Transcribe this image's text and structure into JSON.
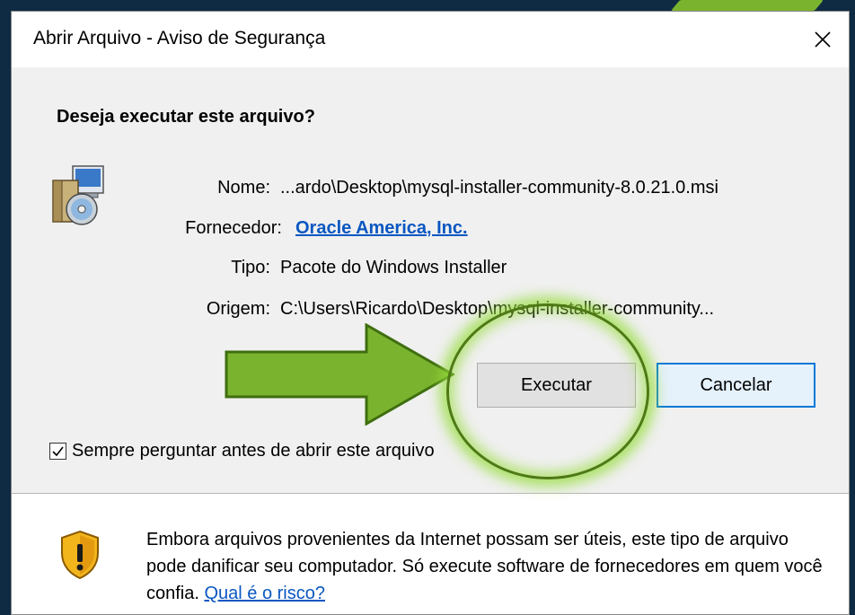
{
  "dialog": {
    "title": "Abrir Arquivo - Aviso de Segurança",
    "close_glyph": "✕",
    "question": "Deseja executar este arquivo?",
    "fields": {
      "name_label": "Nome:",
      "name_value": "...ardo\\Desktop\\mysql-installer-community-8.0.21.0.msi",
      "vendor_label": "Fornecedor:",
      "vendor_value": "Oracle America, Inc.",
      "type_label": "Tipo:",
      "type_value": "Pacote do Windows Installer",
      "origin_label": "Origem:",
      "origin_value": "C:\\Users\\Ricardo\\Desktop\\mysql-installer-community..."
    },
    "buttons": {
      "execute": "Executar",
      "cancel": "Cancelar"
    },
    "checkbox": {
      "label": "Sempre perguntar antes de abrir este arquivo",
      "checked": true
    },
    "warning": {
      "text": "Embora arquivos provenientes da Internet possam ser úteis, este tipo de arquivo pode danificar seu computador. Só execute software de fornecedores em quem você confia. ",
      "link": "Qual é o risco?"
    }
  },
  "icons": {
    "file": "installer-package-icon",
    "warning": "shield-warning-icon"
  },
  "colors": {
    "accent_arrow": "#7ab32e",
    "highlight_glow": "#96dc3c",
    "link": "#0a57c2",
    "focus_border": "#0078d7"
  }
}
